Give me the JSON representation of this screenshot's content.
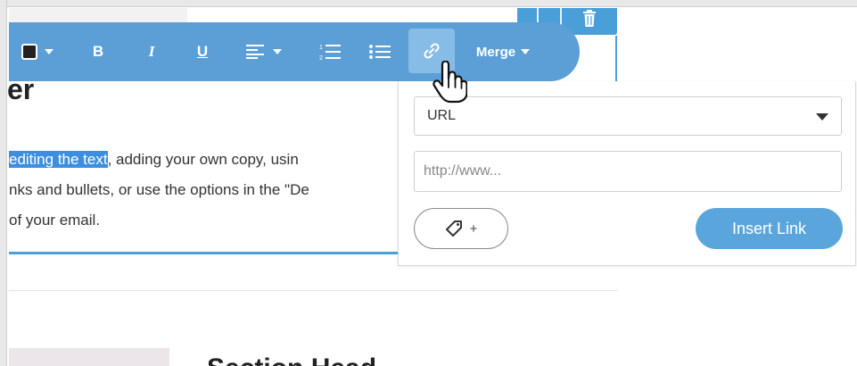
{
  "editor": {
    "heading_fragment": "er",
    "body_lines": {
      "line1_selected": "editing the text",
      "line1_rest": ", adding your own copy, usin",
      "line2": "nks and bullets, or use the options in the \"De",
      "line3": "of your email."
    },
    "section_heading_fragment": "Section Head"
  },
  "toolbar": {
    "bold_label": "B",
    "italic_label": "I",
    "underline_label": "U",
    "merge_label": "Merge",
    "text_color": "#222222",
    "background": "#5b9fd6",
    "active_item": "link"
  },
  "link_popup": {
    "type_select_value": "URL",
    "url_placeholder": "http://www...",
    "tag_button_label": "+",
    "insert_button_label": "Insert Link"
  },
  "colors": {
    "accent": "#4a9fd8",
    "selection": "#3b8ee0",
    "insert_button": "#5aa6dc"
  },
  "icons": [
    "trash-icon",
    "color-swatch-icon",
    "chevron-down-icon",
    "align-left-icon",
    "ordered-list-icon",
    "bullet-list-icon",
    "link-icon",
    "tag-icon",
    "hand-pointer-icon"
  ]
}
